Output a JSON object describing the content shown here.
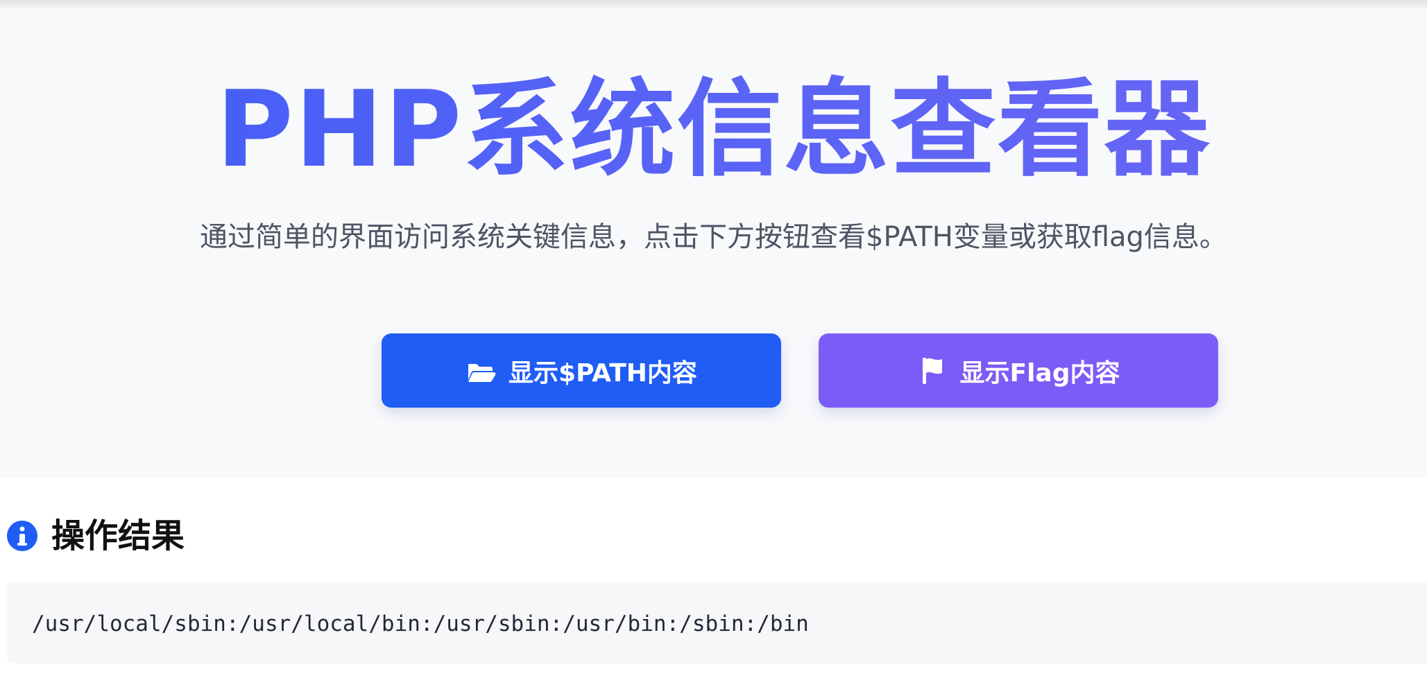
{
  "hero": {
    "title": "PHP系统信息查看器",
    "subtitle": "通过简单的界面访问系统关键信息，点击下方按钮查看$PATH变量或获取flag信息。"
  },
  "buttons": {
    "path_label": "显示$PATH内容",
    "flag_label": "显示Flag内容",
    "path_icon": "folder-open-icon",
    "flag_icon": "flag-icon"
  },
  "result": {
    "title": "操作结果",
    "icon": "info-circle-icon",
    "content": "/usr/local/sbin:/usr/local/bin:/usr/sbin:/usr/bin:/sbin:/bin"
  },
  "colors": {
    "title_accent": "#3f5df7",
    "path_button": "#1f5df5",
    "flag_button": "#7c5cf7",
    "hero_background": "#f8f9fb",
    "result_background": "#f7f7fa"
  }
}
